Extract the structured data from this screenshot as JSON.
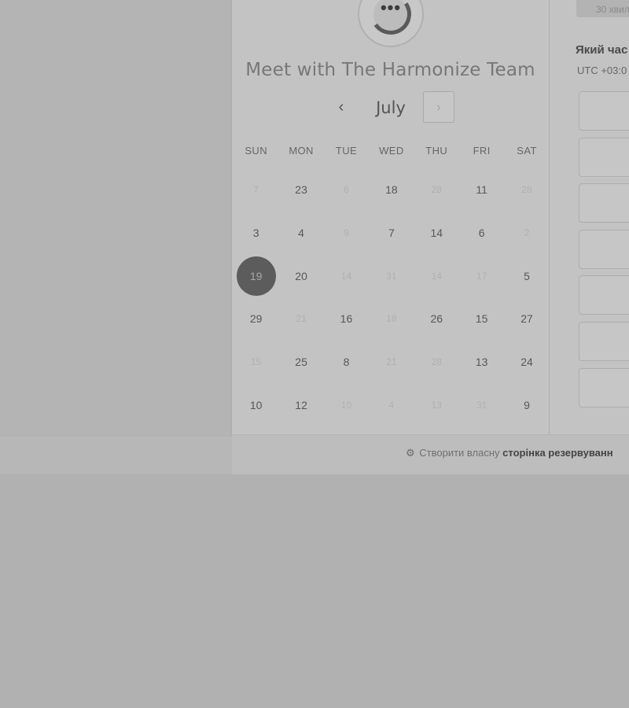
{
  "header": {
    "title": "Meet with The Harmonize Team",
    "avatar_dots": "•••"
  },
  "calendar": {
    "month": "July",
    "prev_icon": "chevron-left-icon",
    "next_icon": "chevron-right-icon",
    "prev_glyph": "‹",
    "next_glyph": "›",
    "weekdays": [
      "SUN",
      "MON",
      "TUE",
      "WED",
      "THU",
      "FRI",
      "SAT"
    ],
    "weeks": [
      [
        {
          "d": "7",
          "s": "unavailable"
        },
        {
          "d": "23",
          "s": "available"
        },
        {
          "d": "6",
          "s": "unavailable"
        },
        {
          "d": "18",
          "s": "available"
        },
        {
          "d": "28",
          "s": "unavailable"
        },
        {
          "d": "11",
          "s": "available"
        },
        {
          "d": "28",
          "s": "unavailable"
        }
      ],
      [
        {
          "d": "3",
          "s": "available"
        },
        {
          "d": "4",
          "s": "available"
        },
        {
          "d": "9",
          "s": "unavailable"
        },
        {
          "d": "7",
          "s": "available"
        },
        {
          "d": "14",
          "s": "available"
        },
        {
          "d": "6",
          "s": "available"
        },
        {
          "d": "2",
          "s": "unavailable"
        }
      ],
      [
        {
          "d": "19",
          "s": "selected"
        },
        {
          "d": "20",
          "s": "available"
        },
        {
          "d": "14",
          "s": "unavailable"
        },
        {
          "d": "31",
          "s": "unavailable"
        },
        {
          "d": "14",
          "s": "unavailable"
        },
        {
          "d": "17",
          "s": "unavailable"
        },
        {
          "d": "5",
          "s": "available"
        }
      ],
      [
        {
          "d": "29",
          "s": "available"
        },
        {
          "d": "21",
          "s": "unavailable"
        },
        {
          "d": "16",
          "s": "available"
        },
        {
          "d": "18",
          "s": "unavailable"
        },
        {
          "d": "26",
          "s": "available"
        },
        {
          "d": "15",
          "s": "available"
        },
        {
          "d": "27",
          "s": "available"
        }
      ],
      [
        {
          "d": "15",
          "s": "unavailable"
        },
        {
          "d": "25",
          "s": "available"
        },
        {
          "d": "8",
          "s": "available"
        },
        {
          "d": "21",
          "s": "unavailable"
        },
        {
          "d": "28",
          "s": "unavailable"
        },
        {
          "d": "13",
          "s": "available"
        },
        {
          "d": "24",
          "s": "available"
        }
      ],
      [
        {
          "d": "10",
          "s": "available"
        },
        {
          "d": "12",
          "s": "available"
        },
        {
          "d": "10",
          "s": "unavailable"
        },
        {
          "d": "4",
          "s": "unavailable"
        },
        {
          "d": "13",
          "s": "unavailable"
        },
        {
          "d": "31",
          "s": "unavailable"
        },
        {
          "d": "9",
          "s": "available"
        }
      ]
    ]
  },
  "scheduler": {
    "duration_label": "30 хвил",
    "time_heading": "Який час",
    "timezone": "UTC +03:0",
    "slot_count": 7
  },
  "footer": {
    "icon": "hubspot-sprocket-icon",
    "icon_glyph": "⚙",
    "prefix": "Створити власну",
    "bold": "сторінка резервуванн"
  }
}
